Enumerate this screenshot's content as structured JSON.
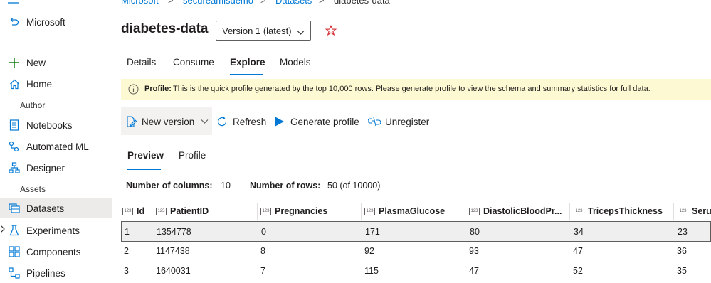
{
  "sidebar": {
    "workspace": "Microsoft",
    "new_label": "New",
    "home_label": "Home",
    "author_section": "Author",
    "notebooks": "Notebooks",
    "automl": "Automated ML",
    "designer": "Designer",
    "assets_section": "Assets",
    "datasets": "Datasets",
    "experiments": "Experiments",
    "components": "Components",
    "pipelines": "Pipelines"
  },
  "breadcrumb": {
    "c1": "Microsoft",
    "c2": "secureamlsdemo",
    "c3": "Datasets",
    "c4": "diabetes-data"
  },
  "page": {
    "title": "diabetes-data",
    "version": "Version 1 (latest)"
  },
  "tabs": {
    "details": "Details",
    "consume": "Consume",
    "explore": "Explore",
    "models": "Models"
  },
  "banner": {
    "bold": "Profile:",
    "text": "This is the quick profile generated by the top 10,000 rows. Please generate profile to view the schema and summary statistics for full data."
  },
  "commands": {
    "new_version": "New version",
    "refresh": "Refresh",
    "generate_profile": "Generate profile",
    "unregister": "Unregister"
  },
  "subtabs": {
    "preview": "Preview",
    "profile": "Profile"
  },
  "stats": {
    "cols_label": "Number of columns:",
    "cols_value": "10",
    "rows_label": "Number of rows:",
    "rows_value": "50 (of 10000)"
  },
  "table": {
    "type_icon": "123",
    "headers": [
      "Id",
      "PatientID",
      "Pregnancies",
      "PlasmaGlucose",
      "DiastolicBloodPr...",
      "TricepsThickness",
      "Serum"
    ],
    "rows": [
      [
        "1",
        "1354778",
        "0",
        "171",
        "80",
        "34",
        "23"
      ],
      [
        "2",
        "1147438",
        "8",
        "92",
        "93",
        "47",
        "36"
      ],
      [
        "3",
        "1640031",
        "7",
        "115",
        "47",
        "52",
        "35"
      ]
    ]
  },
  "colors": {
    "accent": "#0078d4",
    "banner_bg": "#fdf9d2",
    "selected_row": "#efefef"
  }
}
